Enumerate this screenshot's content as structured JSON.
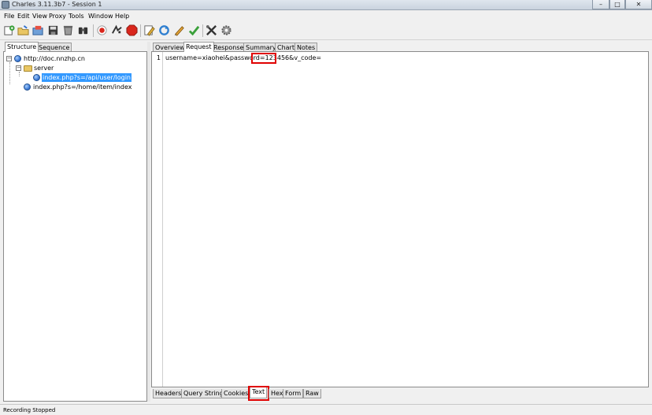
{
  "window": {
    "title": "Charles 3.11.3b7 - Session 1",
    "min_label": "–",
    "max_label": "□",
    "close_label": "✕"
  },
  "menu": [
    "File",
    "Edit",
    "View",
    "Proxy",
    "Tools",
    "Window",
    "Help"
  ],
  "toolbar": {
    "icons": [
      "new-session-icon",
      "open-session-icon",
      "close-session-icon",
      "save-session-icon",
      "clear-session-icon",
      "find-icon",
      "record-icon",
      "throttle-icon",
      "breakpoints-icon",
      "edit-icon",
      "repeat-icon",
      "compose-icon",
      "validate-icon",
      "tools-icon",
      "settings-icon"
    ]
  },
  "left": {
    "tabs": [
      "Structure",
      "Sequence"
    ],
    "active_tab": "Structure",
    "tree": {
      "host": "http://doc.nnzhp.cn",
      "folder": "server",
      "selected_item": "index.php?s=/api/user/login",
      "item2": "index.php?s=/home/item/index"
    }
  },
  "right": {
    "tabs": [
      "Overview",
      "Request",
      "Response",
      "Summary",
      "Chart",
      "Notes"
    ],
    "active_tab": "Request",
    "line_number": "1",
    "body_text": "username=xiaohei&password=123456&v_code=",
    "sub_tabs": [
      "Headers",
      "Query String",
      "Cookies",
      "Text",
      "Hex",
      "Form",
      "Raw"
    ],
    "active_sub_tab": "Text"
  },
  "status": {
    "text": "Recording Stopped"
  },
  "colors": {
    "selection": "#3399ff",
    "highlight_box": "#e00000",
    "record_red": "#d9261c"
  }
}
